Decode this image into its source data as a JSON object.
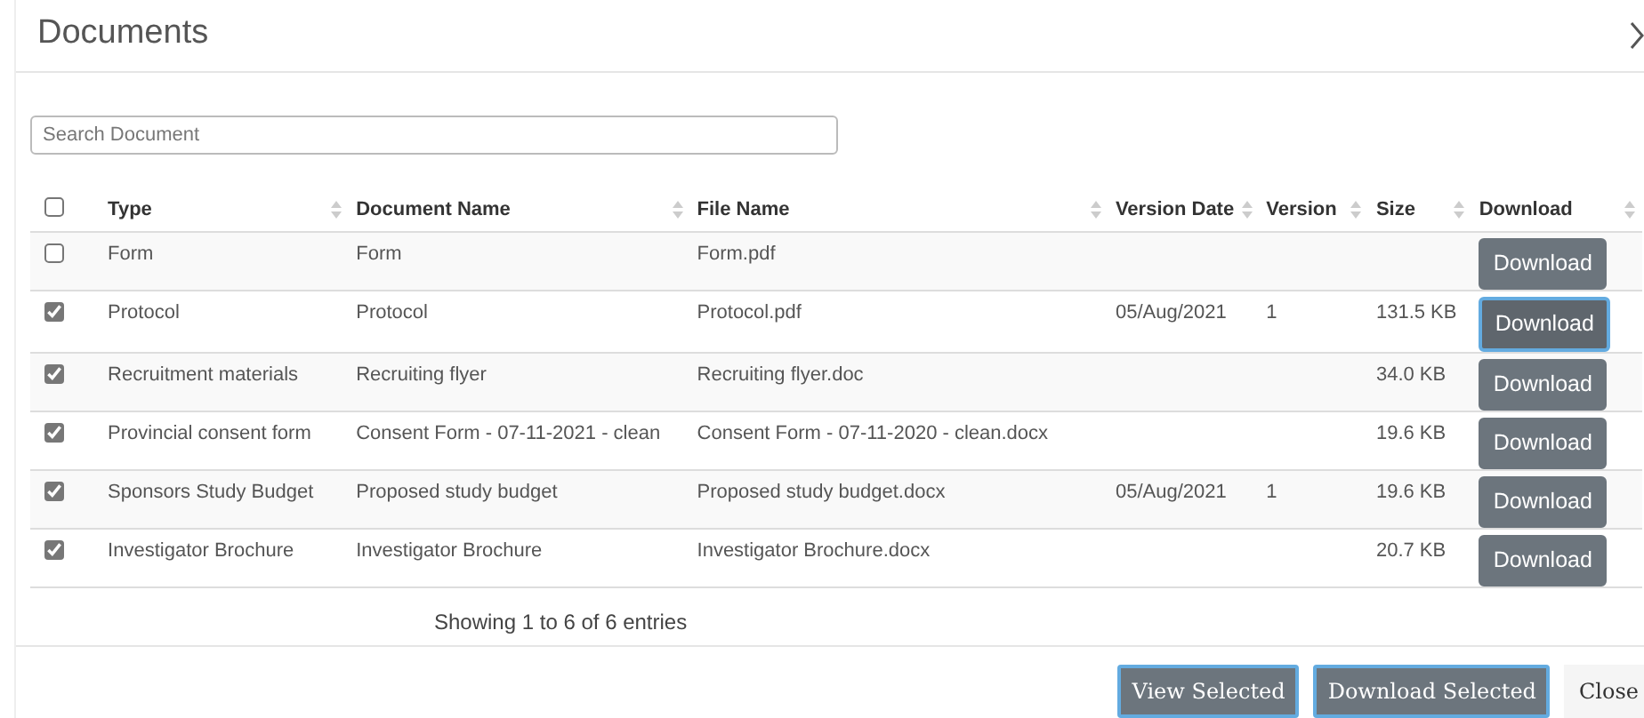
{
  "modal": {
    "title": "Documents"
  },
  "search": {
    "placeholder": "Search Document"
  },
  "table": {
    "select_all": {
      "checked": false
    },
    "columns": [
      "Type",
      "Document Name",
      "File Name",
      "Version Date",
      "Version",
      "Size",
      "Download"
    ],
    "rows": [
      {
        "checked": false,
        "type": "Form",
        "document_name": "Form",
        "file_name": "Form.pdf",
        "version_date": "",
        "version": "",
        "size": "",
        "button": "Download",
        "focused": false
      },
      {
        "checked": true,
        "type": "Protocol",
        "document_name": "Protocol",
        "file_name": "Protocol.pdf",
        "version_date": "05/Aug/2021",
        "version": "1",
        "size": "131.5 KB",
        "button": "Download",
        "focused": true
      },
      {
        "checked": true,
        "type": "Recruitment materials",
        "document_name": "Recruiting flyer",
        "file_name": "Recruiting flyer.doc",
        "version_date": "",
        "version": "",
        "size": "34.0 KB",
        "button": "Download",
        "focused": false
      },
      {
        "checked": true,
        "type": "Provincial consent form",
        "document_name": "Consent Form - 07-11-2021 - clean",
        "file_name": "Consent Form - 07-11-2020 - clean.docx",
        "version_date": "",
        "version": "",
        "size": "19.6 KB",
        "button": "Download",
        "focused": false
      },
      {
        "checked": true,
        "type": "Sponsors Study Budget",
        "document_name": "Proposed study budget",
        "file_name": "Proposed study budget.docx",
        "version_date": "05/Aug/2021",
        "version": "1",
        "size": "19.6 KB",
        "button": "Download",
        "focused": false
      },
      {
        "checked": true,
        "type": "Investigator Brochure",
        "document_name": "Investigator Brochure",
        "file_name": "Investigator Brochure.docx",
        "version_date": "",
        "version": "",
        "size": "20.7 KB",
        "button": "Download",
        "focused": false
      }
    ],
    "info": "Showing 1 to 6 of 6 entries"
  },
  "footer_buttons": [
    {
      "label": "View Selected",
      "kind": "primary"
    },
    {
      "label": "Download Selected",
      "kind": "primary"
    },
    {
      "label": "Close",
      "kind": "plain"
    }
  ]
}
